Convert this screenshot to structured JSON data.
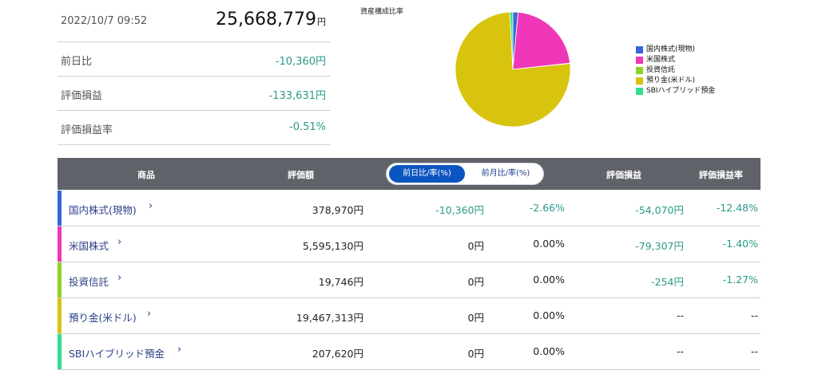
{
  "summary": {
    "timestamp": "2022/10/7 09:52",
    "total": "25,668,779",
    "total_unit": "円",
    "rows": [
      {
        "label": "前日比",
        "value": "-10,360円"
      },
      {
        "label": "評価損益",
        "value": "-133,631円"
      },
      {
        "label": "評価損益率",
        "value": "-0.51%"
      }
    ]
  },
  "chart_data": {
    "type": "pie",
    "title": "資産構成比率",
    "legend_position": "right",
    "categories": [
      "国内株式(現物)",
      "米国株式",
      "投資信託",
      "預り金(米ドル)",
      "SBIハイブリッド預金"
    ],
    "values": [
      378970,
      5595130,
      19746,
      19467313,
      207620
    ],
    "colors": [
      "#3766dc",
      "#f036b8",
      "#8fd12a",
      "#d8c40e",
      "#2ee08e"
    ]
  },
  "table": {
    "headers": {
      "product": "商品",
      "valuation": "評価額",
      "pl": "評価損益",
      "pl_rate": "評価損益率"
    },
    "toggle": {
      "option1": "前日比/率(%)",
      "option2": "前月比/率(%)"
    },
    "chevron": "›",
    "rows": [
      {
        "name": "国内株式(現物)",
        "valuation": "378,970円",
        "diff": "-10,360円",
        "diff_rate": "-2.66%",
        "pl": "-54,070円",
        "pl_rate": "-12.48%"
      },
      {
        "name": "米国株式",
        "valuation": "5,595,130円",
        "diff": "0円",
        "diff_rate": "0.00%",
        "pl": "-79,307円",
        "pl_rate": "-1.40%"
      },
      {
        "name": "投資信託",
        "valuation": "19,746円",
        "diff": "0円",
        "diff_rate": "0.00%",
        "pl": "-254円",
        "pl_rate": "-1.27%"
      },
      {
        "name": "預り金(米ドル)",
        "valuation": "19,467,313円",
        "diff": "0円",
        "diff_rate": "0.00%",
        "pl": "--",
        "pl_rate": "--"
      },
      {
        "name": "SBIハイブリッド預金",
        "valuation": "207,620円",
        "diff": "0円",
        "diff_rate": "0.00%",
        "pl": "--",
        "pl_rate": "--"
      }
    ]
  }
}
